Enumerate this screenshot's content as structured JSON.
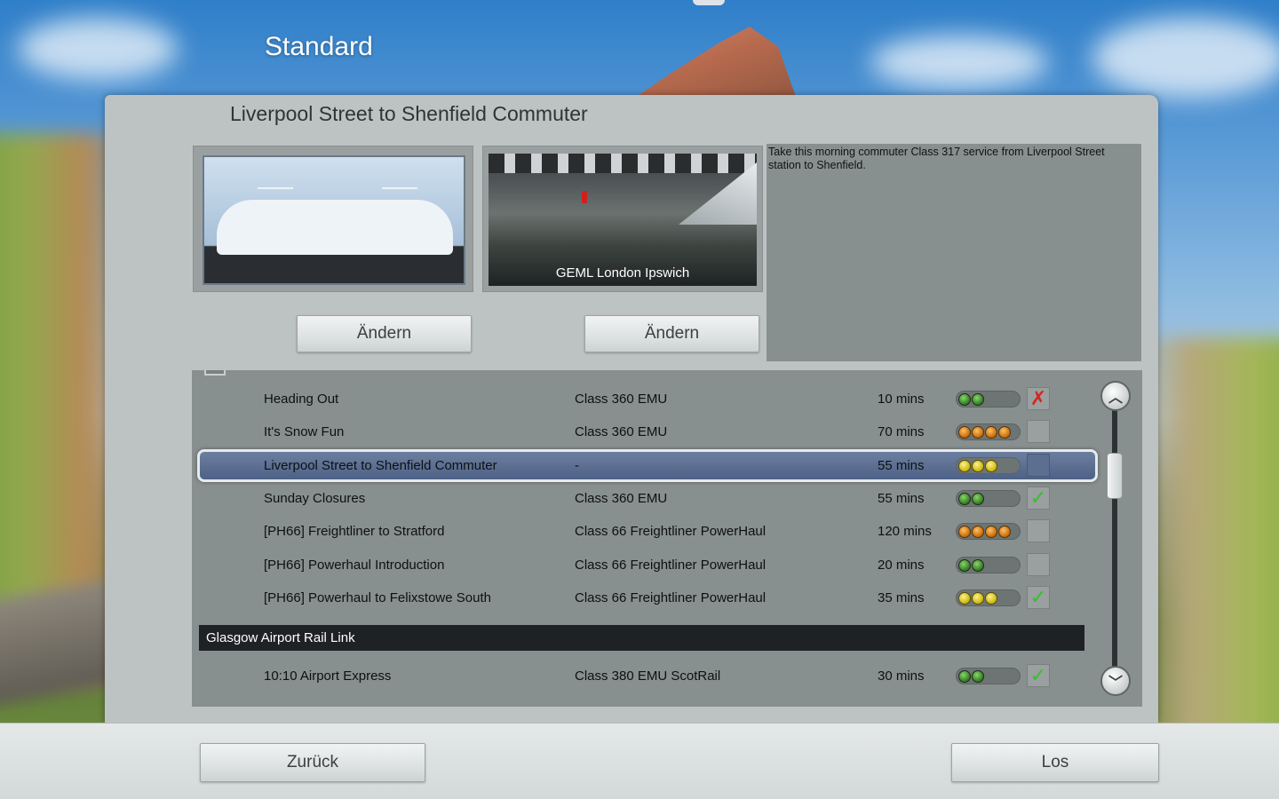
{
  "mode_heading": "Standard",
  "scenario": {
    "title": "Liverpool Street to Shenfield Commuter",
    "route_caption": "GEML London Ipswich",
    "description": "Take this morning commuter Class 317 service from Liverpool Street station to Shenfield.",
    "change_loco_label": "Ändern",
    "change_route_label": "Ändern"
  },
  "list": {
    "rows": [
      {
        "name": "Heading Out",
        "train": "Class 360 EMU",
        "duration": "10 mins",
        "difficulty": 2,
        "difficulty_color": "green",
        "status": "failed",
        "status_icon": "cross-icon"
      },
      {
        "name": "It's Snow Fun",
        "train": "Class 360 EMU",
        "duration": "70 mins",
        "difficulty": 4,
        "difficulty_color": "orange",
        "status": "none",
        "status_icon": ""
      },
      {
        "name": "Liverpool Street to Shenfield Commuter",
        "train": "-",
        "duration": "55 mins",
        "difficulty": 3,
        "difficulty_color": "yellow",
        "status": "none",
        "status_icon": "",
        "selected": true
      },
      {
        "name": "Sunday Closures",
        "train": "Class 360 EMU",
        "duration": "55 mins",
        "difficulty": 2,
        "difficulty_color": "green",
        "status": "completed",
        "status_icon": "check-icon"
      },
      {
        "name": "[PH66] Freightliner to Stratford",
        "train": "Class 66 Freightliner PowerHaul",
        "duration": "120 mins",
        "difficulty": 4,
        "difficulty_color": "orange",
        "status": "none",
        "status_icon": ""
      },
      {
        "name": "[PH66] Powerhaul Introduction",
        "train": "Class 66 Freightliner PowerHaul",
        "duration": "20 mins",
        "difficulty": 2,
        "difficulty_color": "green",
        "status": "none",
        "status_icon": ""
      },
      {
        "name": "[PH66] Powerhaul to Felixstowe South",
        "train": "Class 66 Freightliner PowerHaul",
        "duration": "35 mins",
        "difficulty": 3,
        "difficulty_color": "yellow",
        "status": "completed",
        "status_icon": "check-icon"
      }
    ],
    "group_header": "Glasgow Airport Rail Link",
    "group_rows": [
      {
        "name": "10:10 Airport Express",
        "train": "Class 380 EMU ScotRail",
        "duration": "30 mins",
        "difficulty": 2,
        "difficulty_color": "green",
        "status": "completed",
        "status_icon": "check-icon"
      }
    ],
    "scroll_up_icon": "chevron-up-icon",
    "scroll_down_icon": "chevron-down-icon"
  },
  "footer": {
    "back_label": "Zurück",
    "go_label": "Los"
  },
  "colors": {
    "panel": "#bdc3c3",
    "list_bg": "#888f8f",
    "selected_row": "#5a6d92",
    "check": "#34c12a",
    "cross": "#d4261f"
  }
}
